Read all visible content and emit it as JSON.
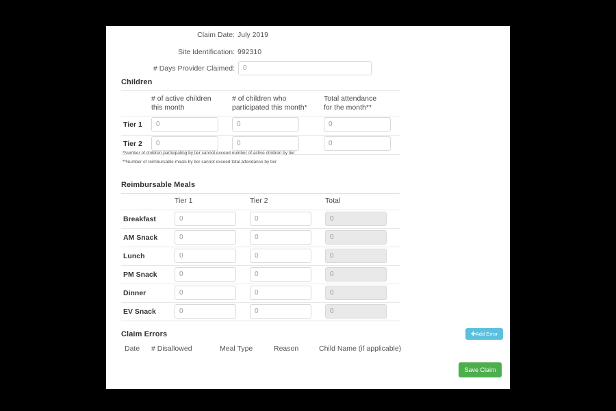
{
  "summary": {
    "claim_date_label": "Claim Date:",
    "claim_date_value": "July 2019",
    "site_id_label": "Site Identification:",
    "site_id_value": "992310",
    "days_claimed_label": "# Days Provider Claimed:",
    "days_claimed_value": "0"
  },
  "children": {
    "title": "Children",
    "columns": [
      "# of active children\nthis month",
      "# of children who\nparticipated this month*",
      "Total attendance\nfor the month**"
    ],
    "rows": [
      {
        "label": "Tier 1",
        "values": [
          "0",
          "0",
          "0"
        ]
      },
      {
        "label": "Tier 2",
        "values": [
          "0",
          "0",
          "0"
        ]
      }
    ],
    "footnotes": [
      "*Number of children participating by tier cannot exceed number of active children by tier",
      "**Number of reimbursable meals by tier cannot exceed total attendance by tier"
    ]
  },
  "meals": {
    "title": "Reimbursable Meals",
    "columns": [
      "Tier 1",
      "Tier 2",
      "Total"
    ],
    "rows": [
      {
        "label": "Breakfast",
        "values": [
          "0",
          "0",
          "0"
        ]
      },
      {
        "label": "AM Snack",
        "values": [
          "0",
          "0",
          "0"
        ]
      },
      {
        "label": "Lunch",
        "values": [
          "0",
          "0",
          "0"
        ]
      },
      {
        "label": "PM Snack",
        "values": [
          "0",
          "0",
          "0"
        ]
      },
      {
        "label": "Dinner",
        "values": [
          "0",
          "0",
          "0"
        ]
      },
      {
        "label": "EV Snack",
        "values": [
          "0",
          "0",
          "0"
        ]
      }
    ]
  },
  "claim_errors": {
    "title": "Claim Errors",
    "columns": [
      "Date",
      "# Disallowed",
      "Meal Type",
      "Reason",
      "Child Name (if applicable)"
    ],
    "add_button_icon": "plus-icon",
    "add_button_label": "Add Error"
  },
  "actions": {
    "save_label": "Save Claim"
  },
  "colors": {
    "add_button": "#5bc0de",
    "save_button": "#4cae4c",
    "page_background": "#000000",
    "card_background": "#ffffff",
    "disabled_field": "#e9e9e9"
  }
}
